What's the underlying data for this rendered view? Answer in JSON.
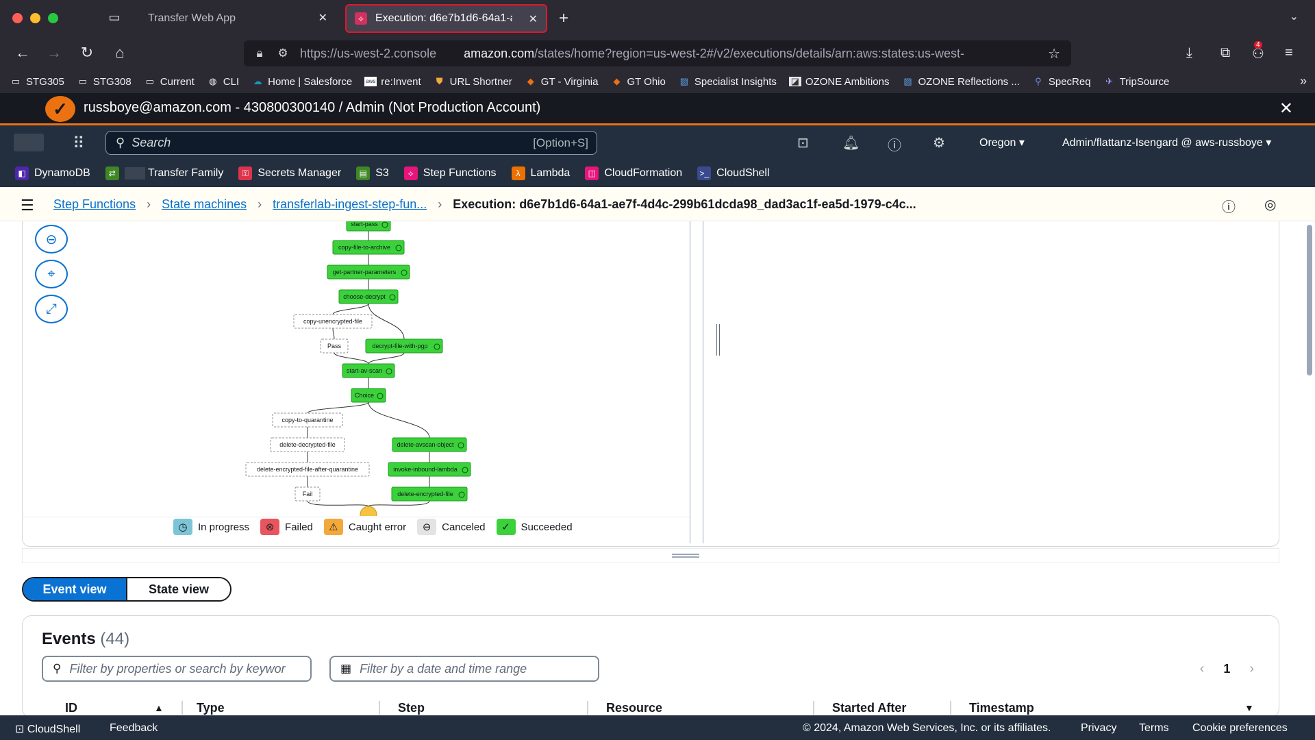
{
  "browser": {
    "tabs": [
      {
        "label": "Transfer Web App"
      },
      {
        "label": "Execution: d6e7b1d6-64a1-ae7f"
      }
    ],
    "url_prefix": "https://us-west-2.console",
    "url_host": "amazon.com",
    "url_path": "/states/home?region=us-west-2#/v2/executions/details/arn:aws:states:us-west-",
    "extension_badge": "4",
    "bookmarks": [
      {
        "label": "STG305",
        "icon": "folder-icon"
      },
      {
        "label": "STG308",
        "icon": "folder-icon"
      },
      {
        "label": "Current",
        "icon": "folder-icon"
      },
      {
        "label": "CLI",
        "icon": "globe-icon"
      },
      {
        "label": "Home | Salesforce",
        "icon": "cloud-icon"
      },
      {
        "label": "re:Invent",
        "icon": "aws-icon"
      },
      {
        "label": "URL Shortner",
        "icon": "shield-icon"
      },
      {
        "label": "GT - Virginia",
        "icon": "cube-icon"
      },
      {
        "label": "GT Ohio",
        "icon": "cube-icon"
      },
      {
        "label": "Specialist Insights",
        "icon": "chart-icon"
      },
      {
        "label": "OZONE Ambitions",
        "icon": "image-icon"
      },
      {
        "label": "OZONE Reflections ...",
        "icon": "chart-icon"
      },
      {
        "label": "SpecReq",
        "icon": "search-icon"
      },
      {
        "label": "TripSource",
        "icon": "plane-icon"
      }
    ]
  },
  "account_banner": {
    "text": "russboye@amazon.com - 430800300140 / Admin (Not Production Account)"
  },
  "console": {
    "search_placeholder": "Search",
    "search_shortcut": "[Option+S]",
    "region": "Oregon",
    "account": "Admin/flattanz-Isengard @ aws-russboye",
    "favorites": [
      {
        "label": "DynamoDB",
        "color": "#4d27aa"
      },
      {
        "label": "Transfer Family",
        "color": "#3f8624"
      },
      {
        "label": "Secrets Manager",
        "color": "#dd344c"
      },
      {
        "label": "S3",
        "color": "#3f8624"
      },
      {
        "label": "Step Functions",
        "color": "#e7157b"
      },
      {
        "label": "Lambda",
        "color": "#ed7100"
      },
      {
        "label": "CloudFormation",
        "color": "#e7157b"
      },
      {
        "label": "CloudShell",
        "color": "#232f3e"
      }
    ]
  },
  "breadcrumb": {
    "items": [
      "Step Functions",
      "State machines",
      "transferlab-ingest-step-fun..."
    ],
    "current": "Execution: d6e7b1d6-64a1-ae7f-4d4c-299b61dcda98_dad3ac1f-ea5d-1979-c4c..."
  },
  "graph": {
    "nodes": [
      {
        "id": "start-pass",
        "label": "start-pass",
        "status": "succeeded"
      },
      {
        "id": "copy-file-to-archive",
        "label": "copy-file-to-archive",
        "status": "succeeded"
      },
      {
        "id": "get-partner-parameters",
        "label": "get-partner-parameters",
        "status": "succeeded"
      },
      {
        "id": "choose-decrypt",
        "label": "choose-decrypt",
        "status": "succeeded"
      },
      {
        "id": "copy-unencrypted-file",
        "label": "copy-unencrypted-file",
        "status": "not-run"
      },
      {
        "id": "pass",
        "label": "Pass",
        "status": "not-run"
      },
      {
        "id": "decrypt-file-with-pgp",
        "label": "decrypt-file-with-pgp",
        "status": "succeeded"
      },
      {
        "id": "start-av-scan",
        "label": "start-av-scan",
        "status": "succeeded"
      },
      {
        "id": "choice",
        "label": "Choice",
        "status": "succeeded"
      },
      {
        "id": "copy-to-quarantine",
        "label": "copy-to-quarantine",
        "status": "not-run"
      },
      {
        "id": "delete-decrypted-file",
        "label": "delete-decrypted-file",
        "status": "not-run"
      },
      {
        "id": "delete-encrypted-file-after-quarantine",
        "label": "delete-encrypted-file-after-quarantine",
        "status": "not-run"
      },
      {
        "id": "fail",
        "label": "Fail",
        "status": "not-run"
      },
      {
        "id": "delete-avscan-object",
        "label": "delete-avscan-object",
        "status": "succeeded"
      },
      {
        "id": "invoke-inbound-lambda",
        "label": "invoke-inbound-lambda",
        "status": "succeeded"
      },
      {
        "id": "delete-encrypted-file",
        "label": "delete-encrypted-file",
        "status": "succeeded"
      }
    ],
    "legend": [
      {
        "label": "In progress",
        "icon": "clock-icon",
        "color": "#7cc5d6"
      },
      {
        "label": "Failed",
        "icon": "x-circle-icon",
        "color": "#e8555d"
      },
      {
        "label": "Caught error",
        "icon": "warning-icon",
        "color": "#f2a93b"
      },
      {
        "label": "Canceled",
        "icon": "minus-circle-icon",
        "color": "#e3e3e3"
      },
      {
        "label": "Succeeded",
        "icon": "check-circle-icon",
        "color": "#3bd13b"
      }
    ]
  },
  "view_toggle": {
    "event_view": "Event view",
    "state_view": "State view"
  },
  "events": {
    "title": "Events",
    "count": "(44)",
    "filter_placeholder": "Filter by properties or search by keywor",
    "date_placeholder": "Filter by a date and time range",
    "page": "1",
    "columns": [
      "ID",
      "Type",
      "Step",
      "Resource",
      "Started After",
      "Timestamp"
    ]
  },
  "footer": {
    "cloudshell": "CloudShell",
    "feedback": "Feedback",
    "copyright": "© 2024, Amazon Web Services, Inc. or its affiliates.",
    "privacy": "Privacy",
    "terms": "Terms",
    "cookies": "Cookie preferences"
  }
}
